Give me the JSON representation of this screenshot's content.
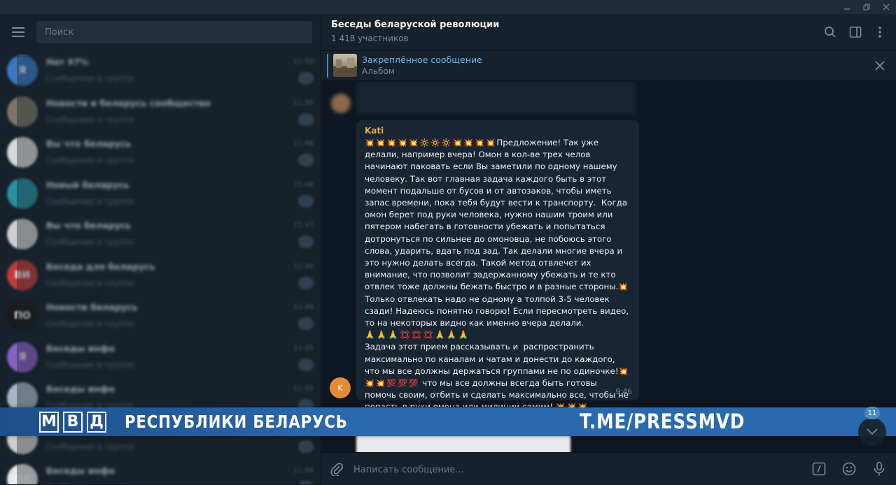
{
  "header": {
    "title": "Беседы беларуской революции",
    "members": "1 418 участников"
  },
  "pinned": {
    "title": "Закреплённое сообщение",
    "subtitle": "Альбом"
  },
  "search": {
    "placeholder": "Поиск"
  },
  "sidebar": {
    "chats": [
      {
        "avatar_letter": "Я",
        "title": "Нат 97%",
        "time": "11:50",
        "preview": "Сообщение в группе",
        "unread": ""
      },
      {
        "avatar_letter": "",
        "title": "Новости и беларусь сообщество",
        "time": "11:50",
        "preview": "Сообщение в группе",
        "unread": ""
      },
      {
        "avatar_letter": "",
        "title": "Вы что беларусь",
        "time": "11:48",
        "preview": "Сообщение в группе",
        "unread": ""
      },
      {
        "avatar_letter": "",
        "title": "Новый беларусь",
        "time": "11:48",
        "preview": "Сообщение в группе",
        "unread": ""
      },
      {
        "avatar_letter": "",
        "title": "Вы что беларусь",
        "time": "11:47",
        "preview": "Сообщение в группе",
        "unread": ""
      },
      {
        "avatar_letter": "ВИ",
        "title": "Беседа для беларусь",
        "time": "11:46",
        "preview": "Сообщение в группе",
        "unread": ""
      },
      {
        "avatar_letter": "ПО",
        "title": "Новости беларусь",
        "time": "11:46",
        "preview": "Сообщение в группе",
        "unread": ""
      },
      {
        "avatar_letter": "Я",
        "title": "Беседы инфо",
        "time": "11:45",
        "preview": "Сообщение в группе",
        "unread": ""
      },
      {
        "avatar_letter": "",
        "title": "Беседы инфо",
        "time": "11:45",
        "preview": "Сообщение в группе",
        "unread": ""
      },
      {
        "avatar_letter": "",
        "title": "Беседы инфо",
        "time": "11:44",
        "preview": "Сообщение в группе",
        "unread": ""
      },
      {
        "avatar_letter": "ОЛ",
        "title": "Беседы инфо",
        "time": "11:44",
        "preview": "Сообщение в группе",
        "unread": ""
      }
    ]
  },
  "message": {
    "sender": "Kati",
    "avatar_letter": "K",
    "time": "9:46",
    "emoji_row_1": "💥💥💥💥💥🔆🔆🔆💥💥💥💥",
    "text_1": "Предложение! Так уже делали, например вчера! Омон в кол-ве трех челов начинают паковать если Вы заметили по одному нашему  человеку. Так вот главная задача каждого быть в этот момент подальше от бусов и от автозаков, чтобы иметь запас времени, пока тебя будут вести к транспорту.  Когда омон берет под руки человека, нужно нашим троим или пятером набегать в готовности убежать и попытаться дотронуться по сильнее до омоновца, не побоюсь этого слова, ударить, вдать под зад. Так делали многие вчера и это нужно делать всегда. Такой метод отвлечет их внимание, что позволит задержанному убежать и те кто отвлек тоже должны бежать быстро и в разные стороны.",
    "emoji_mid": "💥",
    "text_2": " Только отвлекать надо не одному а толпой 3-5 человек сзади! Надеюсь понятно говорю! Если пересмотреть видео, то на некоторых видно как именно вчера делали.",
    "emoji_row_2": "🙏🙏🙏💢💢💢🙏🙏🙏",
    "text_3": "Задача этот прием рассказывать и  распространить максимально по каналам и чатам и донести до каждого, что мы все должны держаться группами не по одиночке!",
    "emoji_row_3": "💥💥💥💯💯💯",
    "text_4": " что мы все должны всегда быть готовы помочь своим, отбить и сделать максимально все, чтобы не попасть в руки омона или милиции самим!",
    "emoji_end": "💥💥💥"
  },
  "watermark": {
    "letters": [
      "М",
      "В",
      "Д"
    ],
    "text": "РЕСПУБЛИКИ БЕЛАРУСЬ",
    "url": "T.ME/PRESSMVD"
  },
  "scroll_badge": "11",
  "input": {
    "placeholder": "Написать сообщение..."
  },
  "colors": {
    "accent": "#5288c1",
    "link": "#6ab2f2",
    "sender": "#e6a55a",
    "watermark": "#2a69ad"
  }
}
